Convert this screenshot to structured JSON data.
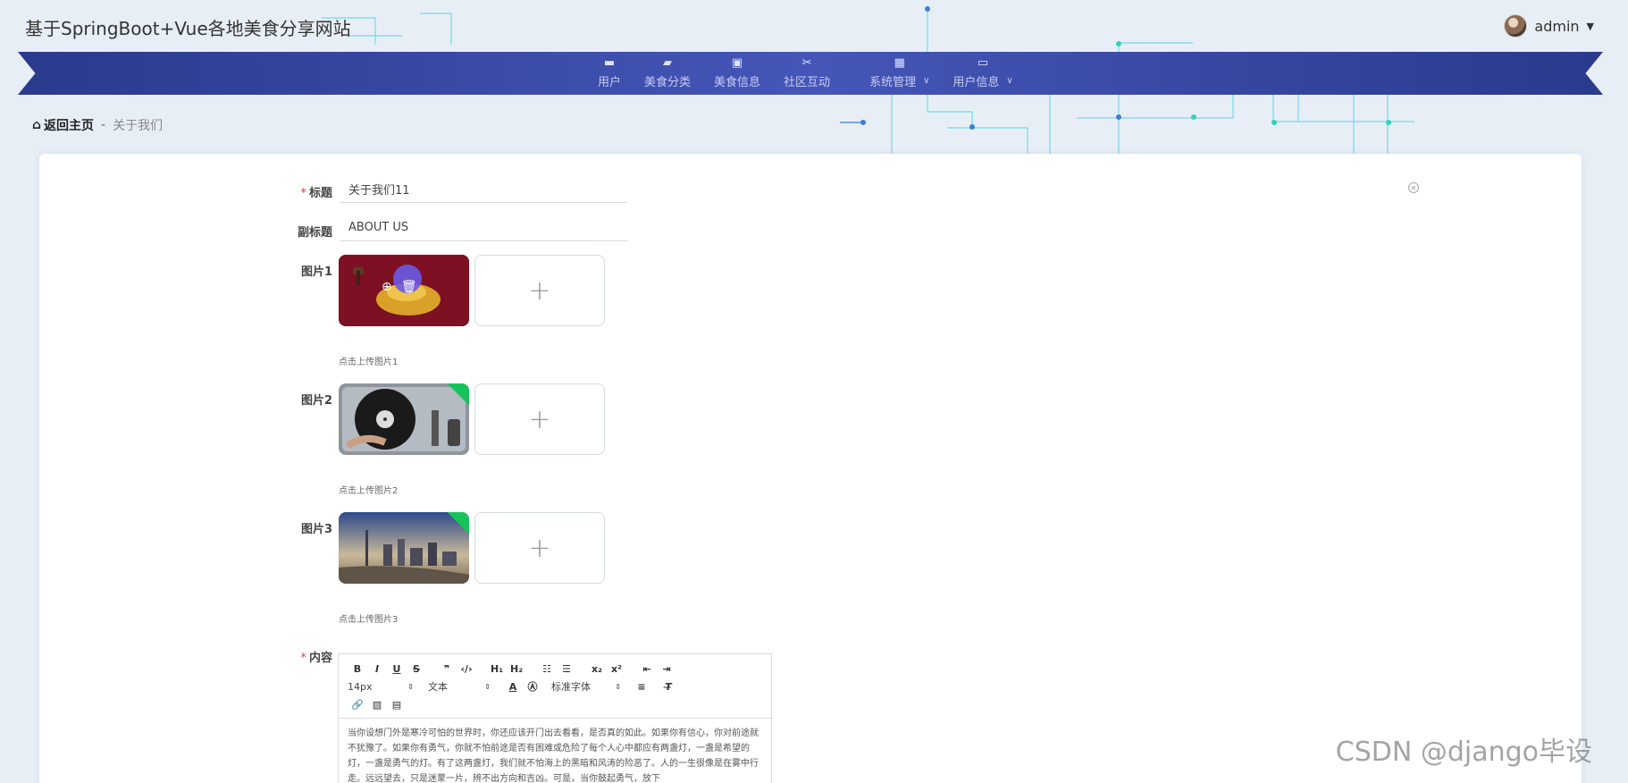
{
  "app": {
    "title": "基于SpringBoot+Vue各地美食分享网站",
    "user": "admin"
  },
  "nav": [
    {
      "label": "用户",
      "icon": "monitor-icon",
      "dropdown": false
    },
    {
      "label": "美食分类",
      "icon": "food-icon",
      "dropdown": false
    },
    {
      "label": "美食信息",
      "icon": "clipboard-icon",
      "dropdown": false
    },
    {
      "label": "社区互动",
      "icon": "ticket-icon",
      "dropdown": false
    },
    {
      "label": "系统管理",
      "icon": "grid-icon",
      "dropdown": true
    },
    {
      "label": "用户信息",
      "icon": "card-icon",
      "dropdown": true
    }
  ],
  "breadcrumb": {
    "home": "返回主页",
    "separator": "-",
    "current": "关于我们"
  },
  "form": {
    "title_label": "标题",
    "title_value": "关于我们11",
    "subtitle_label": "副标题",
    "subtitle_value": "ABOUT US",
    "image1_label": "图片1",
    "image1_hint": "点击上传图片1",
    "image2_label": "图片2",
    "image2_hint": "点击上传图片2",
    "image3_label": "图片3",
    "image3_hint": "点击上传图片3",
    "upload_plus": "+",
    "content_label": "内容"
  },
  "editor": {
    "font_size": "14px",
    "header_select": "文本",
    "font_family": "标准字体",
    "text": "当你设想门外是寒冷可怕的世界时，你还应该开门出去看看，是否真的如此。如果你有信心，你对前途就不犹豫了。如果你有勇气，你就不怕前途是否有困难或危险了每个人心中都应有两盏灯，一盏是希望的灯，一盏是勇气的灯。有了这两盏灯，我们就不怕海上的黑暗和风涛的险恶了。人的一生很像是在雾中行走。远远望去，只是迷蒙一片，辨不出方向和吉凶。可是，当你鼓起勇气，放下"
  },
  "watermark": "CSDN @django毕设",
  "colors": {
    "nav_bg": "#3a4aa8",
    "required": "#e34444",
    "badge": "#18c25a",
    "page_bg": "#e8eef6"
  }
}
